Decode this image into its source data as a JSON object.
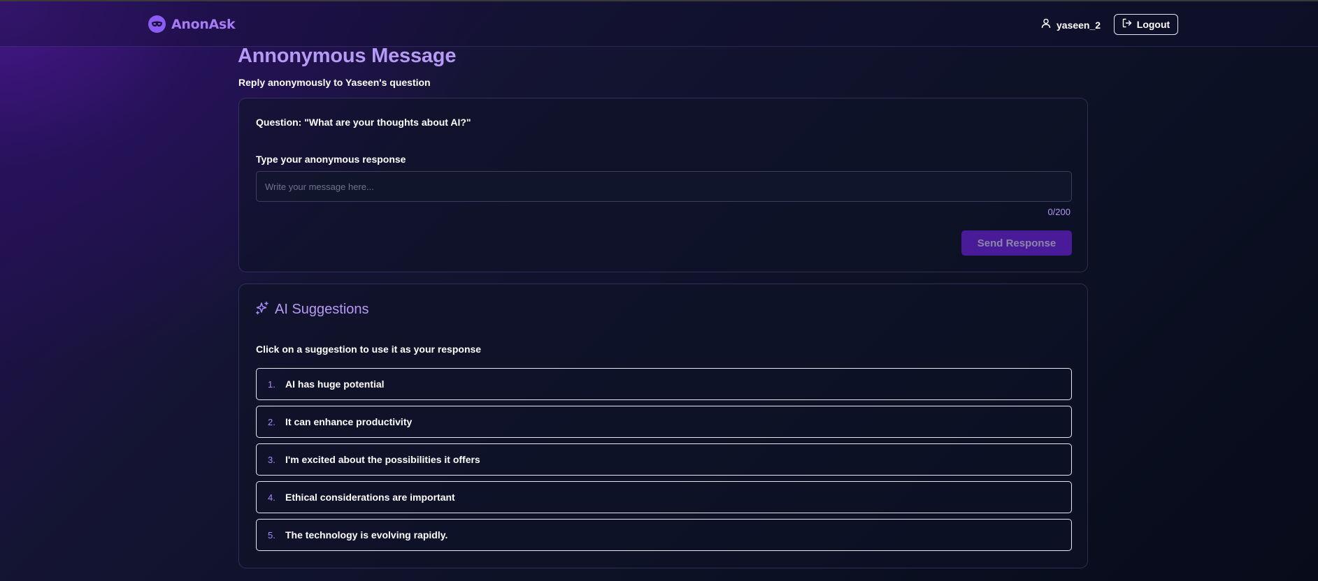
{
  "navbar": {
    "brand_name": "AnonAsk",
    "brand_icon": "mask-icon",
    "user_icon": "user-icon",
    "username": "yaseen_2",
    "logout_icon": "logout-icon",
    "logout_label": "Logout"
  },
  "page": {
    "title": "Annonymous Message",
    "subtitle": "Reply anonymously to Yaseen's question"
  },
  "response_card": {
    "question": "Question: \"What are your thoughts about AI?\"",
    "input_label": "Type your anonymous response",
    "input_placeholder": "Write your message here...",
    "input_value": "",
    "char_count": "0/200",
    "send_label": "Send Response"
  },
  "suggestions_card": {
    "icon": "sparkles-icon",
    "title": "AI Suggestions",
    "hint": "Click on a suggestion to use it as your response",
    "items": [
      {
        "num": "1.",
        "text": "AI has huge potential"
      },
      {
        "num": "2.",
        "text": "It can enhance productivity"
      },
      {
        "num": "3.",
        "text": "I'm excited about the possibilities it offers"
      },
      {
        "num": "4.",
        "text": "Ethical considerations are important"
      },
      {
        "num": "5.",
        "text": "The technology is evolving rapidly."
      }
    ]
  },
  "colors": {
    "accent": "#a77bf3",
    "title": "#b79af6",
    "button_bg": "#4a1b99"
  }
}
